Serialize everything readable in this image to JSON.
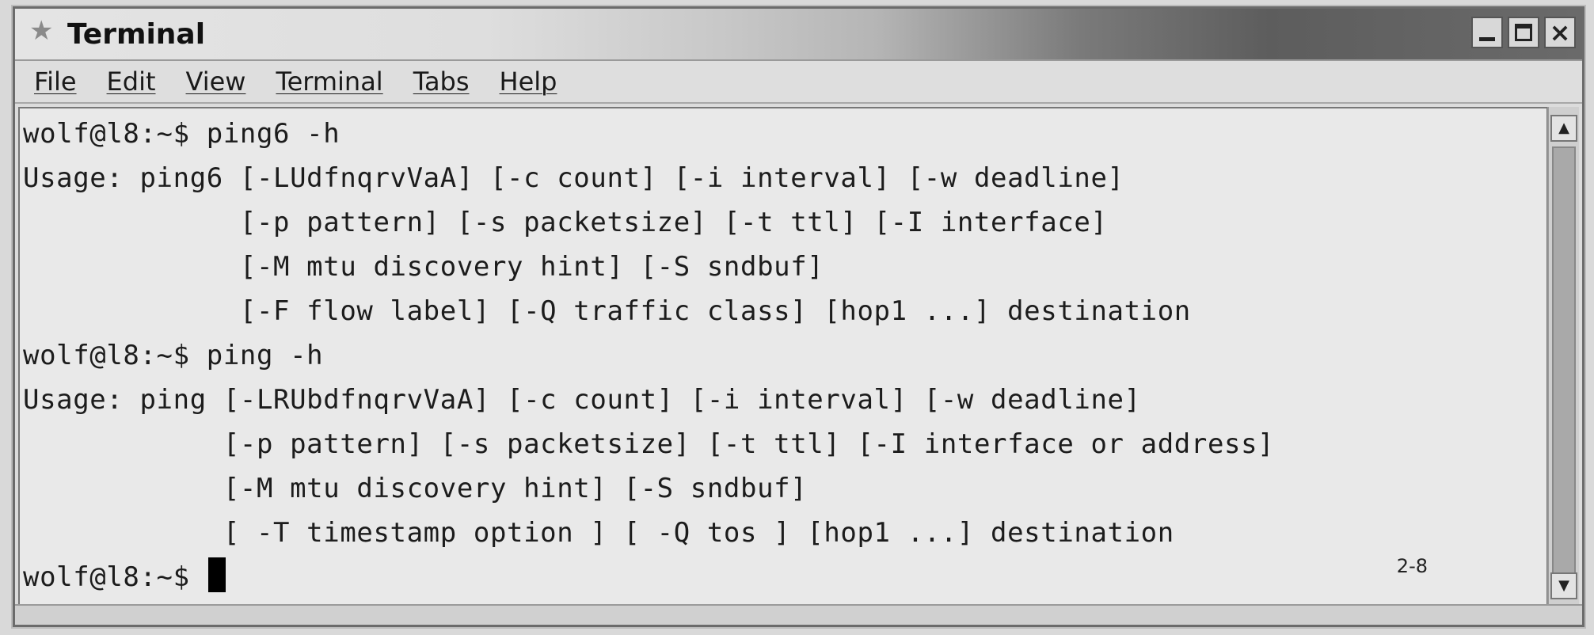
{
  "window": {
    "title": "Terminal",
    "controls": [
      "minimize",
      "maximize",
      "close"
    ]
  },
  "menubar": {
    "items": [
      "File",
      "Edit",
      "View",
      "Terminal",
      "Tabs",
      "Help"
    ]
  },
  "terminal": {
    "lines": [
      "wolf@l8:~$ ping6 -h",
      "Usage: ping6 [-LUdfnqrvVaA] [-c count] [-i interval] [-w deadline]",
      "             [-p pattern] [-s packetsize] [-t ttl] [-I interface]",
      "             [-M mtu discovery hint] [-S sndbuf]",
      "             [-F flow label] [-Q traffic class] [hop1 ...] destination",
      "wolf@l8:~$ ping -h",
      "Usage: ping [-LRUbdfnqrvVaA] [-c count] [-i interval] [-w deadline]",
      "            [-p pattern] [-s packetsize] [-t ttl] [-I interface or address]",
      "            [-M mtu discovery hint] [-S sndbuf]",
      "            [ -T timestamp option ] [ -Q tos ] [hop1 ...] destination"
    ],
    "prompt": "wolf@l8:~$ ",
    "status": "2-8"
  },
  "icons": {
    "title": "star-icon",
    "close": "close-icon",
    "scroll_up": "arrow-up-icon",
    "scroll_down": "arrow-down-icon"
  }
}
